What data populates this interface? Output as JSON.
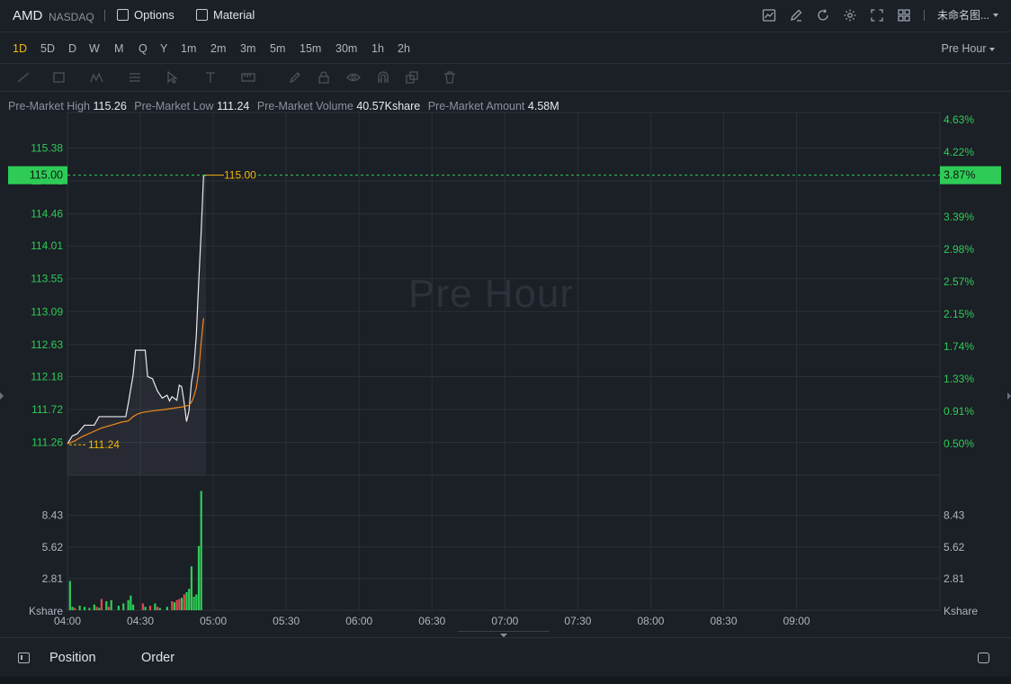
{
  "header": {
    "symbol": "AMD",
    "exchange": "NASDAQ",
    "options_label": "Options",
    "material_label": "Material",
    "layout_name": "未命名图..."
  },
  "intervals": [
    "1D",
    "5D",
    "D",
    "W",
    "M",
    "Q",
    "Y",
    "1m",
    "2m",
    "3m",
    "5m",
    "15m",
    "30m",
    "1h",
    "2h"
  ],
  "active_interval": "1D",
  "session_select": "Pre Hour",
  "stats": {
    "high_label": "Pre-Market High",
    "high_value": "115.26",
    "low_label": "Pre-Market Low",
    "low_value": "111.24",
    "volume_label": "Pre-Market Volume",
    "volume_value": "40.57Kshare",
    "amount_label": "Pre-Market Amount",
    "amount_value": "4.58M"
  },
  "watermark": "Pre Hour",
  "bottom": {
    "position_label": "Position",
    "order_label": "Order"
  },
  "colors": {
    "up": "#2ecc57",
    "down": "#e0494f",
    "avg": "#f08a1c",
    "price": "#e8eaed",
    "current": "#2ecc57",
    "label": "#f0b90b"
  },
  "chart_data": {
    "type": "line",
    "x_ticks": [
      "04:00",
      "04:30",
      "05:00",
      "05:30",
      "06:00",
      "06:30",
      "07:00",
      "07:30",
      "08:00",
      "08:30",
      "09:00"
    ],
    "y_ticks": [
      "115.38",
      "114.92",
      "114.46",
      "114.01",
      "113.55",
      "113.09",
      "112.63",
      "112.18",
      "111.72",
      "111.26"
    ],
    "pct_ticks": [
      "4.63%",
      "4.22%",
      "3.87%",
      "3.39%",
      "2.98%",
      "2.57%",
      "2.15%",
      "1.74%",
      "1.33%",
      "0.91%",
      "0.50%"
    ],
    "ylim": [
      110.8,
      115.84
    ],
    "xlim": [
      "04:00",
      "09:59"
    ],
    "current_price": "115.00",
    "current_pct": "3.87%",
    "low_marker": "111.24",
    "series": [
      {
        "values": [
          [
            "04:00",
            111.24
          ],
          [
            "04:02",
            111.35
          ],
          [
            "04:04",
            111.38
          ],
          [
            "04:06",
            111.46
          ],
          [
            "04:07",
            111.5
          ],
          [
            "04:09",
            111.5
          ],
          [
            "04:11",
            111.5
          ],
          [
            "04:13",
            111.62
          ],
          [
            "04:15",
            111.62
          ],
          [
            "04:18",
            111.62
          ],
          [
            "04:20",
            111.62
          ],
          [
            "04:24",
            111.62
          ],
          [
            "04:25",
            111.8
          ],
          [
            "04:27",
            112.2
          ],
          [
            "04:28",
            112.55
          ],
          [
            "04:30",
            112.55
          ],
          [
            "04:32",
            112.55
          ],
          [
            "04:33",
            112.18
          ],
          [
            "04:35",
            112.15
          ],
          [
            "04:37",
            111.98
          ],
          [
            "04:39",
            111.88
          ],
          [
            "04:41",
            111.92
          ],
          [
            "04:42",
            111.84
          ],
          [
            "04:43",
            111.9
          ],
          [
            "04:45",
            111.85
          ],
          [
            "04:46",
            112.06
          ],
          [
            "04:47",
            112.04
          ],
          [
            "04:48",
            111.82
          ],
          [
            "04:49",
            111.55
          ],
          [
            "04:50",
            111.7
          ],
          [
            "04:51",
            112.1
          ],
          [
            "04:52",
            112.3
          ],
          [
            "04:53",
            112.75
          ],
          [
            "04:54",
            113.5
          ],
          [
            "04:55",
            114.2
          ],
          [
            "04:56",
            115.0
          ],
          [
            "04:57",
            115.0
          ]
        ]
      },
      {
        "values": [
          [
            "04:00",
            111.24
          ],
          [
            "04:03",
            111.28
          ],
          [
            "04:06",
            111.34
          ],
          [
            "04:10",
            111.4
          ],
          [
            "04:14",
            111.46
          ],
          [
            "04:18",
            111.5
          ],
          [
            "04:22",
            111.54
          ],
          [
            "04:25",
            111.56
          ],
          [
            "04:27",
            111.62
          ],
          [
            "04:29",
            111.66
          ],
          [
            "04:31",
            111.68
          ],
          [
            "04:35",
            111.7
          ],
          [
            "04:40",
            111.72
          ],
          [
            "04:44",
            111.74
          ],
          [
            "04:48",
            111.76
          ],
          [
            "04:50",
            111.78
          ],
          [
            "04:51",
            111.82
          ],
          [
            "04:52",
            111.9
          ],
          [
            "04:53",
            112.02
          ],
          [
            "04:54",
            112.25
          ],
          [
            "04:55",
            112.65
          ],
          [
            "04:56",
            113.0
          ]
        ]
      }
    ],
    "volume": {
      "y_ticks": [
        "8.43",
        "5.62",
        "2.81"
      ],
      "unit": "Kshare",
      "ylim": [
        0,
        12
      ],
      "bars": [
        [
          "04:01",
          2.6,
          "up"
        ],
        [
          "04:02",
          0.3,
          "up"
        ],
        [
          "04:03",
          0.2,
          "down"
        ],
        [
          "04:05",
          0.4,
          "up"
        ],
        [
          "04:07",
          0.3,
          "up"
        ],
        [
          "04:09",
          0.2,
          "up"
        ],
        [
          "04:11",
          0.5,
          "up"
        ],
        [
          "04:12",
          0.3,
          "down"
        ],
        [
          "04:13",
          0.2,
          "up"
        ],
        [
          "04:14",
          1.0,
          "down"
        ],
        [
          "04:16",
          0.8,
          "up"
        ],
        [
          "04:17",
          0.3,
          "down"
        ],
        [
          "04:18",
          0.9,
          "up"
        ],
        [
          "04:21",
          0.4,
          "up"
        ],
        [
          "04:23",
          0.6,
          "up"
        ],
        [
          "04:25",
          0.9,
          "up"
        ],
        [
          "04:26",
          1.3,
          "up"
        ],
        [
          "04:27",
          0.5,
          "up"
        ],
        [
          "04:31",
          0.6,
          "down"
        ],
        [
          "04:32",
          0.3,
          "up"
        ],
        [
          "04:34",
          0.4,
          "down"
        ],
        [
          "04:36",
          0.6,
          "up"
        ],
        [
          "04:37",
          0.3,
          "down"
        ],
        [
          "04:38",
          0.2,
          "up"
        ],
        [
          "04:41",
          0.3,
          "up"
        ],
        [
          "04:43",
          0.8,
          "down"
        ],
        [
          "04:44",
          0.7,
          "up"
        ],
        [
          "04:45",
          0.9,
          "down"
        ],
        [
          "04:46",
          1.0,
          "down"
        ],
        [
          "04:47",
          1.1,
          "up"
        ],
        [
          "04:48",
          1.4,
          "down"
        ],
        [
          "04:49",
          1.6,
          "up"
        ],
        [
          "04:50",
          1.9,
          "up"
        ],
        [
          "04:51",
          3.9,
          "up"
        ],
        [
          "04:52",
          1.2,
          "up"
        ],
        [
          "04:53",
          1.4,
          "up"
        ],
        [
          "04:54",
          5.7,
          "up"
        ],
        [
          "04:55",
          10.6,
          "up"
        ]
      ]
    }
  }
}
